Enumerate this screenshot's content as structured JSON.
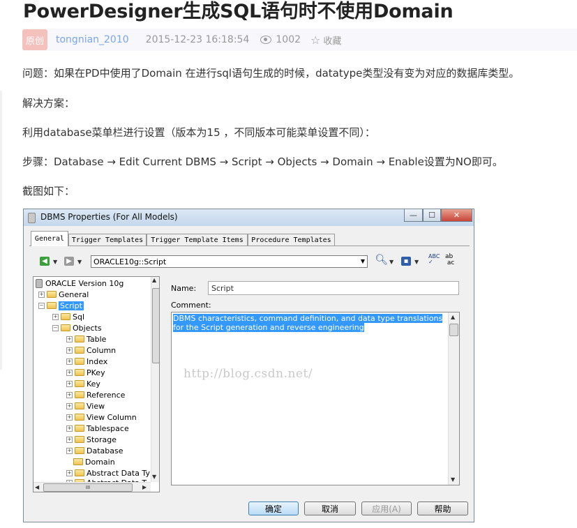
{
  "article": {
    "title": "PowerDesigner生成SQL语句时不使用Domain",
    "badge": "原创",
    "author": "tongnian_2010",
    "date": "2015-12-23 16:18:54",
    "views": "1002",
    "favorite": "收藏",
    "paragraphs": [
      "问题：如果在PD中使用了Domain 在进行sql语句生成的时候，datatype类型没有变为对应的数据库类型。",
      "解决方案：",
      "利用database菜单栏进行设置（版本为15 ，不同版本可能菜单设置不同）：",
      "步骤：Database → Edit Current DBMS → Script → Objects → Domain → Enable设置为NO即可。",
      "截图如下："
    ]
  },
  "dialog": {
    "title": "DBMS Properties (For All Models)",
    "tabs": [
      "General",
      "Trigger Templates",
      "Trigger Template Items",
      "Procedure Templates"
    ],
    "combo_value": "ORACLE10g::Script",
    "tree": {
      "root": "ORACLE Version 10g",
      "general": "General",
      "script": "Script",
      "sql": "Sql",
      "objects": "Objects",
      "object_items": [
        "Table",
        "Column",
        "Index",
        "PKey",
        "Key",
        "Reference",
        "View",
        "View Column",
        "Tablespace",
        "Storage",
        "Database",
        "Domain",
        "Abstract Data Typ",
        "Abstract Data T"
      ]
    },
    "name_label": "Name:",
    "name_value": "Script",
    "comment_label": "Comment:",
    "comment_text": "DBMS characteristics, command definition, and data type translations for the Script generation and reverse engineering",
    "watermark": "http://blog.csdn.net/",
    "buttons": {
      "ok": "确定",
      "cancel": "取消",
      "apply": "应用(A)",
      "help": "帮助"
    },
    "hscroll_thumb": "III"
  }
}
